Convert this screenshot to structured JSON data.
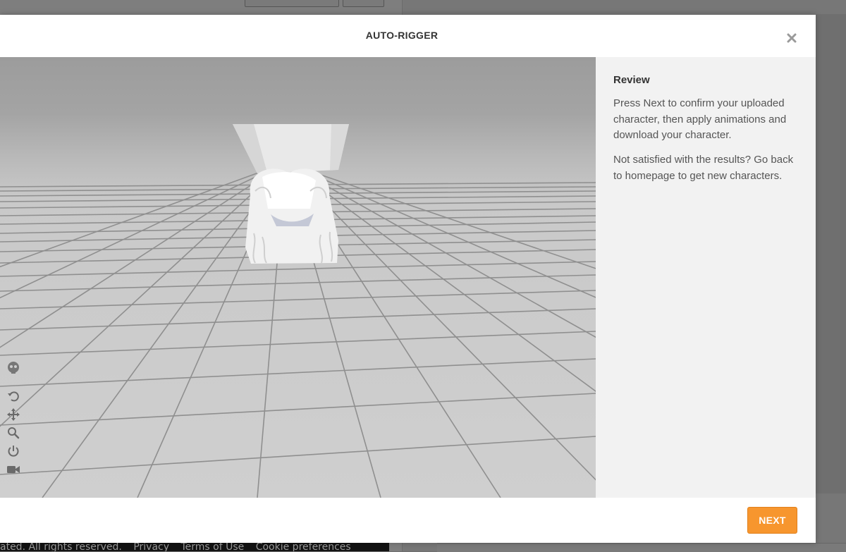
{
  "modal": {
    "title": "AUTO-RIGGER",
    "close_icon": "close-icon",
    "next_label": "NEXT"
  },
  "panel": {
    "heading": "Review",
    "paragraph_1": "Press Next to confirm your uploaded character, then apply animations and download your character.",
    "paragraph_2": "Not satisfied with the results? Go back to homepage to get new characters."
  },
  "viewport_tools": [
    {
      "name": "skeleton-icon"
    },
    {
      "name": "rotate-icon"
    },
    {
      "name": "pan-icon"
    },
    {
      "name": "zoom-icon"
    },
    {
      "name": "power-icon"
    },
    {
      "name": "camera-icon"
    }
  ],
  "background": {
    "footer_copyright": "ated. All rights reserved.",
    "footer_links": [
      "Privacy",
      "Terms of Use",
      "Cookie preferences"
    ]
  },
  "colors": {
    "accent": "#f7962e",
    "panel_bg": "#f2f2f2",
    "overlay": "#777777"
  }
}
